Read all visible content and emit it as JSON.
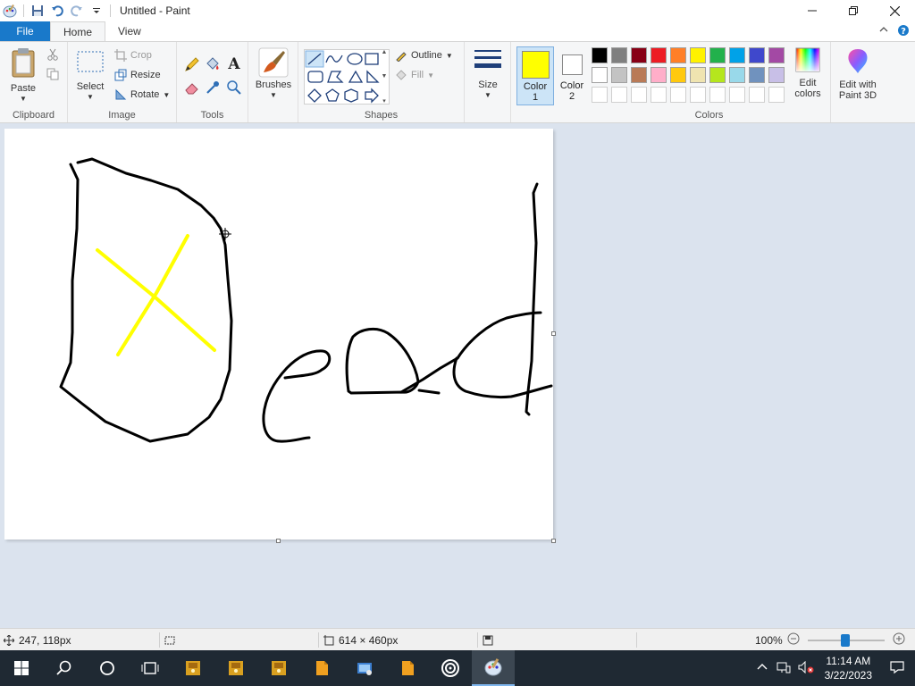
{
  "window": {
    "title": "Untitled - Paint"
  },
  "tabs": {
    "file": "File",
    "home": "Home",
    "view": "View"
  },
  "ribbon": {
    "clipboard": {
      "group_label": "Clipboard",
      "paste": "Paste"
    },
    "image": {
      "group_label": "Image",
      "select": "Select",
      "crop": "Crop",
      "resize": "Resize",
      "rotate": "Rotate"
    },
    "tools": {
      "group_label": "Tools"
    },
    "brushes": {
      "label": "Brushes"
    },
    "shapes": {
      "group_label": "Shapes",
      "outline": "Outline",
      "fill": "Fill"
    },
    "size": {
      "label": "Size"
    },
    "color1": {
      "label": "Color\n1",
      "label_a": "Color",
      "label_b": "1",
      "value": "#ffff00"
    },
    "color2": {
      "label_a": "Color",
      "label_b": "2",
      "value": "#ffffff"
    },
    "colors": {
      "group_label": "Colors",
      "row1": [
        "#000000",
        "#7f7f7f",
        "#880015",
        "#ed1c24",
        "#ff7f27",
        "#fff200",
        "#22b14c",
        "#00a2e8",
        "#3f48cc",
        "#a349a4"
      ],
      "row2": [
        "#ffffff",
        "#c3c3c3",
        "#b97a57",
        "#ffaec9",
        "#ffc90e",
        "#efe4b0",
        "#b5e61d",
        "#99d9ea",
        "#7092be",
        "#c8bfe7"
      ],
      "edit_colors_a": "Edit",
      "edit_colors_b": "colors",
      "paint3d_a": "Edit with",
      "paint3d_b": "Paint 3D"
    }
  },
  "status": {
    "cursor_pos": "247, 118px",
    "canvas_size": "614 × 460px",
    "zoom": "100%",
    "zoom_fraction": 0.5
  },
  "taskbar": {
    "time": "11:14 AM",
    "date": "3/22/2023"
  }
}
